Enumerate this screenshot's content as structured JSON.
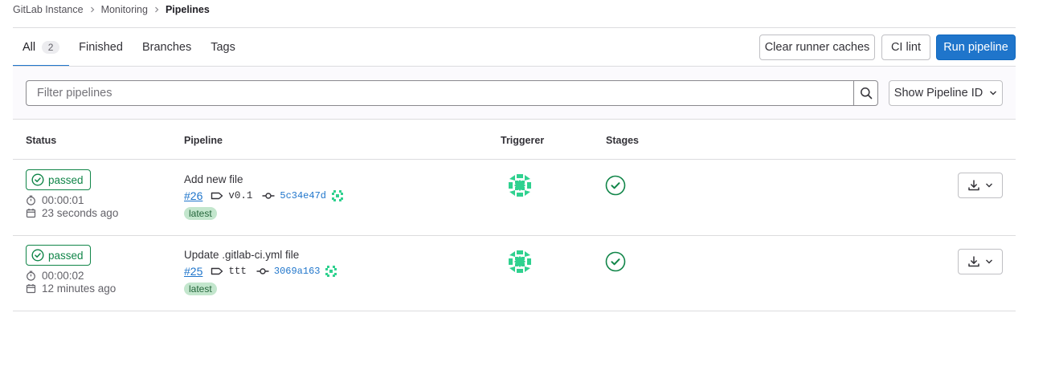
{
  "breadcrumb": [
    "GitLab Instance",
    "Monitoring",
    "Pipelines"
  ],
  "tabs": [
    {
      "label": "All",
      "count": "2"
    },
    {
      "label": "Finished"
    },
    {
      "label": "Branches"
    },
    {
      "label": "Tags"
    }
  ],
  "actions": {
    "clear_caches": "Clear runner caches",
    "ci_lint": "CI lint",
    "run_pipeline": "Run pipeline"
  },
  "filter": {
    "placeholder": "Filter pipelines",
    "dropdown_label": "Show Pipeline ID"
  },
  "table": {
    "headers": {
      "status": "Status",
      "pipeline": "Pipeline",
      "triggerer": "Triggerer",
      "stages": "Stages"
    }
  },
  "rows": [
    {
      "status": "passed",
      "duration": "00:00:01",
      "finished": "23 seconds ago",
      "commit_title": "Add new file",
      "pipeline_id": "#26",
      "ref": "v0.1",
      "sha": "5c34e47d",
      "tag": "latest",
      "stage_status": "success"
    },
    {
      "status": "passed",
      "duration": "00:00:02",
      "finished": "12 minutes ago",
      "commit_title": "Update .gitlab-ci.yml file",
      "pipeline_id": "#25",
      "ref": "ttt",
      "sha": "3069a163",
      "tag": "latest",
      "stage_status": "success"
    }
  ],
  "colors": {
    "success": "#108548",
    "link": "#1f75cb",
    "primary": "#1f75cb",
    "avatar": "#2fd18f",
    "latest_bg": "#c3e6cd"
  }
}
